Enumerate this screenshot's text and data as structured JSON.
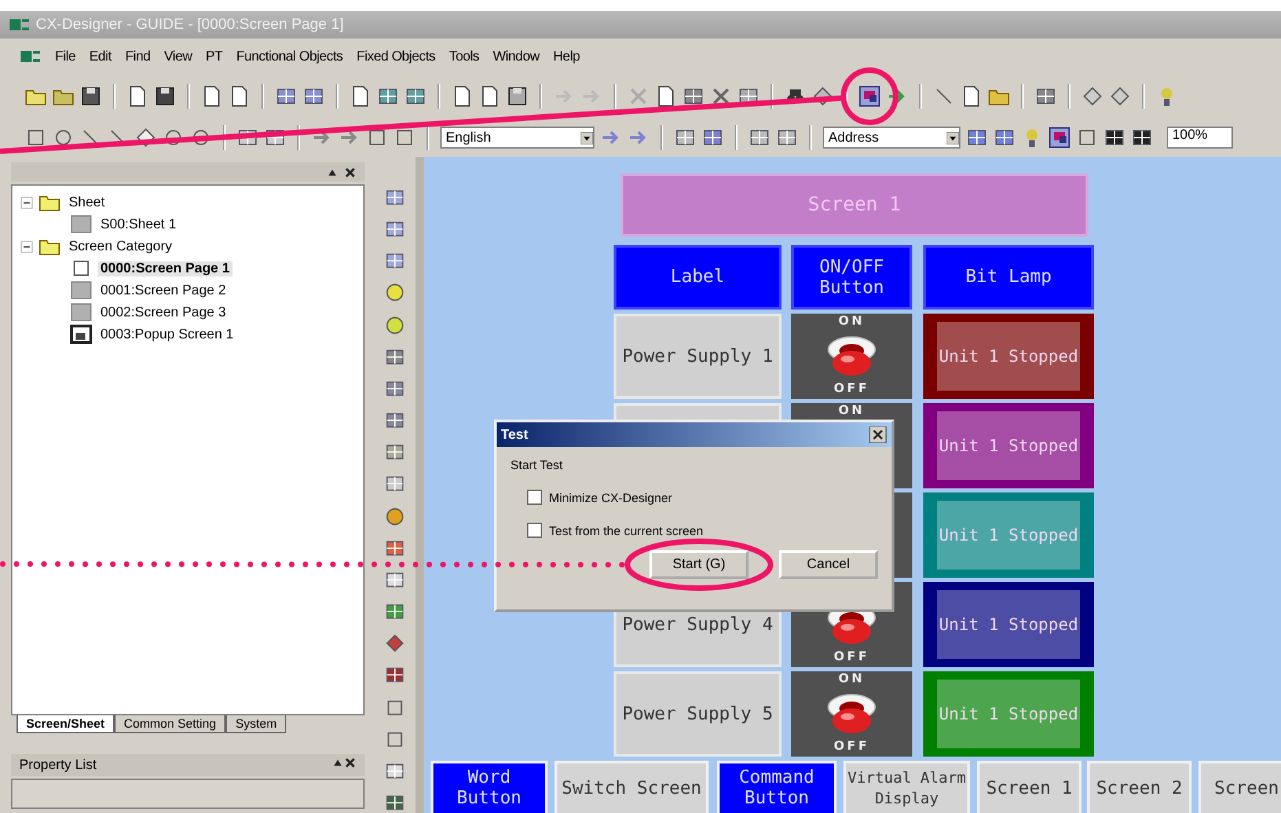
{
  "window": {
    "title": "CX-Designer - GUIDE - [0000:Screen Page 1]"
  },
  "menu": [
    "File",
    "Edit",
    "Find",
    "View",
    "PT",
    "Functional Objects",
    "Fixed Objects",
    "Tools",
    "Window",
    "Help"
  ],
  "toolbar": {
    "language": "English",
    "address": "Address",
    "zoom": "100%"
  },
  "project_tree": {
    "items": [
      {
        "label": "Sheet",
        "kind": "folder",
        "expanded": true,
        "selected": false,
        "children": [
          {
            "label": "S00:Sheet 1",
            "kind": "sheet",
            "selected": false
          }
        ]
      },
      {
        "label": "Screen Category",
        "kind": "folder",
        "expanded": true,
        "selected": false,
        "children": [
          {
            "label": "0000:Screen Page 1",
            "kind": "page",
            "selected": true
          },
          {
            "label": "0001:Screen Page 2",
            "kind": "sheet",
            "selected": false
          },
          {
            "label": "0002:Screen Page 3",
            "kind": "sheet",
            "selected": false
          },
          {
            "label": "0003:Popup Screen 1",
            "kind": "popup",
            "selected": false
          }
        ]
      }
    ],
    "tabs": [
      {
        "label": "Screen/Sheet",
        "selected": true
      },
      {
        "label": "Common Setting",
        "selected": false
      },
      {
        "label": "System",
        "selected": false
      }
    ]
  },
  "property_list": {
    "title": "Property List"
  },
  "screen": {
    "title": "Screen 1",
    "headers": [
      "Label",
      "ON/OFF Button",
      "Bit Lamp"
    ],
    "rows": [
      {
        "label": "Power Supply 1",
        "on_label": "ON",
        "off_label": "OFF",
        "lamp": "Unit 1 Stopped",
        "color": "#7a0000"
      },
      {
        "on_label": "ON",
        "lamp": "Unit 1 Stopped",
        "color": "#800080"
      },
      {
        "lamp": "Unit 1 Stopped",
        "color": "#008080"
      },
      {
        "label": "Power Supply 4",
        "off_label": "OFF",
        "lamp": "Unit 1 Stopped",
        "color": "#000080"
      },
      {
        "label": "Power Supply 5",
        "on_label": "ON",
        "off_label": "OFF",
        "lamp": "Unit 1 Stopped",
        "color": "#008000"
      }
    ],
    "buttons": [
      {
        "label": "Word Button",
        "color": "#0000ff"
      },
      {
        "label": "Switch Screen",
        "color": "#d4d4d4"
      },
      {
        "label": "Command Button",
        "color": "#0000ff"
      },
      {
        "label": "Virtual Alarm Display",
        "color": "#d4d4d4"
      },
      {
        "label": "Screen 1",
        "color": "#d4d4d4"
      },
      {
        "label": "Screen 2",
        "color": "#d4d4d4"
      },
      {
        "label": "Screen",
        "color": "#d4d4d4"
      }
    ]
  },
  "dialog": {
    "title": "Test",
    "heading": "Start Test",
    "options": [
      {
        "label": "Minimize CX-Designer",
        "checked": false
      },
      {
        "label": "Test from the current screen",
        "checked": false
      }
    ],
    "buttons": [
      "Start (G)",
      "Cancel"
    ]
  }
}
